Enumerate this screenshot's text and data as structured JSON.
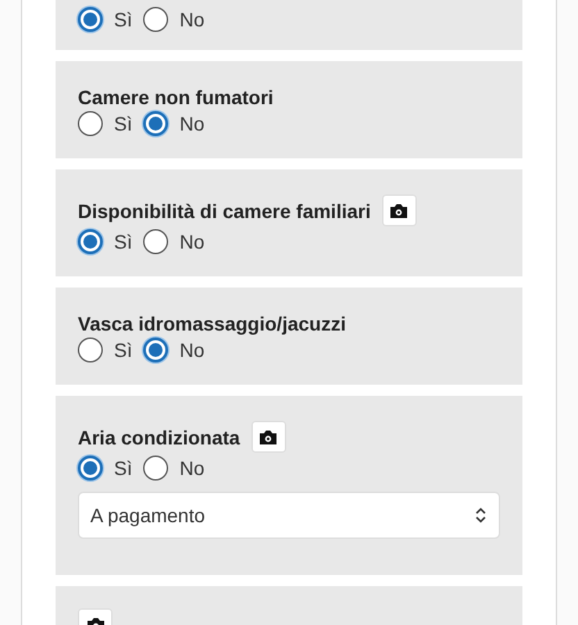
{
  "sections": [
    {
      "photo": false,
      "options": [
        {
          "label": "Sì",
          "selected": true
        },
        {
          "label": "No",
          "selected": false
        }
      ]
    },
    {
      "title": "Camere non fumatori",
      "photo": false,
      "options": [
        {
          "label": "Sì",
          "selected": false
        },
        {
          "label": "No",
          "selected": true
        }
      ]
    },
    {
      "title": "Disponibilità di camere familiari",
      "photo": true,
      "options": [
        {
          "label": "Sì",
          "selected": true
        },
        {
          "label": "No",
          "selected": false
        }
      ]
    },
    {
      "title": "Vasca idromassaggio/jacuzzi",
      "photo": false,
      "options": [
        {
          "label": "Sì",
          "selected": false
        },
        {
          "label": "No",
          "selected": true
        }
      ]
    },
    {
      "title": "Aria condizionata",
      "photo": true,
      "options": [
        {
          "label": "Sì",
          "selected": true
        },
        {
          "label": "No",
          "selected": false
        }
      ],
      "select": {
        "value": "A pagamento"
      }
    },
    {
      "photo": true
    }
  ]
}
